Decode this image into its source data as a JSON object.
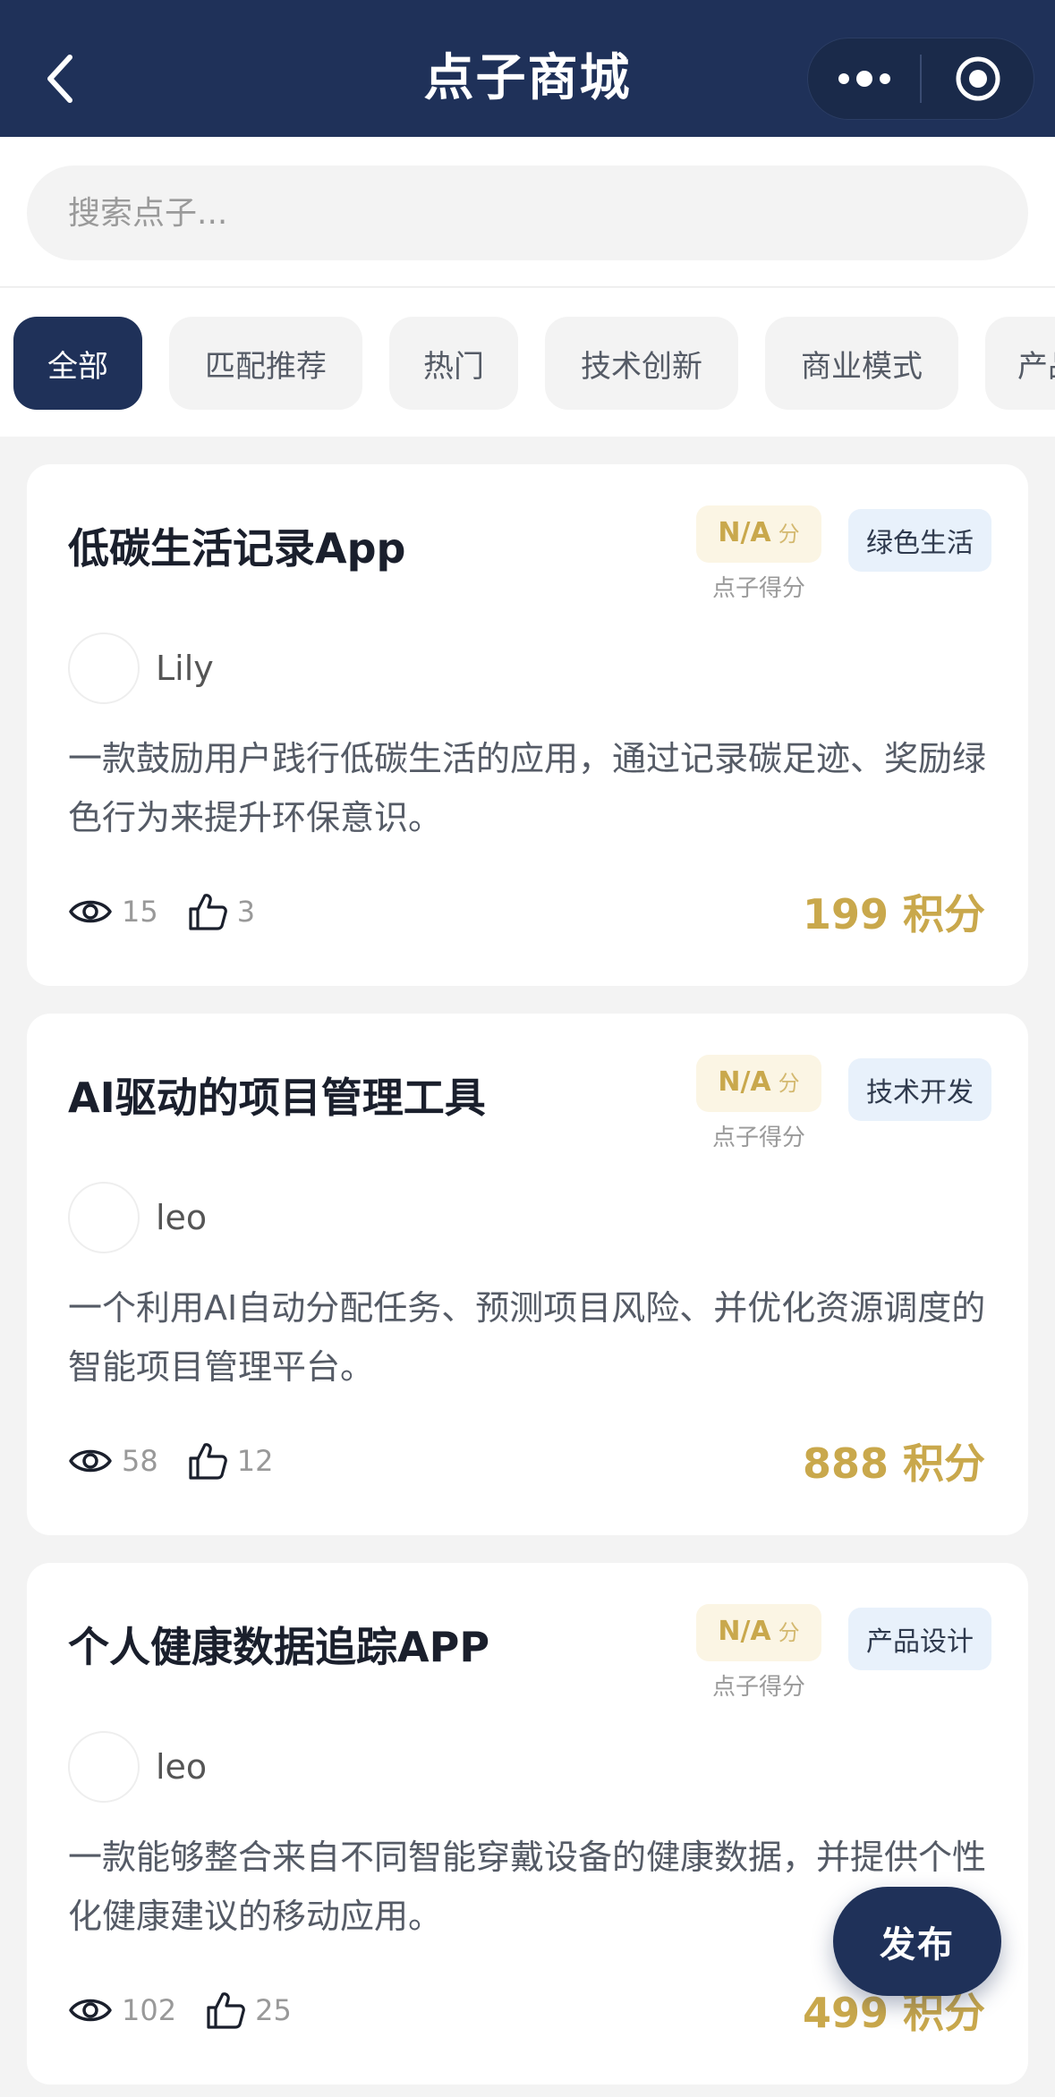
{
  "nav": {
    "title": "点子商城",
    "back_icon": "chevron-left-icon",
    "more_icon": "more-dots-icon",
    "close_icon": "target-circle-icon"
  },
  "search": {
    "placeholder": "搜索点子..."
  },
  "tabs": [
    {
      "label": "全部",
      "active": true
    },
    {
      "label": "匹配推荐",
      "active": false
    },
    {
      "label": "热门",
      "active": false
    },
    {
      "label": "技术创新",
      "active": false
    },
    {
      "label": "商业模式",
      "active": false
    },
    {
      "label": "产品",
      "active": false
    }
  ],
  "cards": [
    {
      "title": "低碳生活记录App",
      "score_value": "N/A",
      "score_unit": "分",
      "score_label": "点子得分",
      "tag": "绿色生活",
      "author": "Lily",
      "description": "一款鼓励用户践行低碳生活的应用，通过记录碳足迹、奖励绿色行为来提升环保意识。",
      "views": "15",
      "likes": "3",
      "price": "199 积分"
    },
    {
      "title": "AI驱动的项目管理工具",
      "score_value": "N/A",
      "score_unit": "分",
      "score_label": "点子得分",
      "tag": "技术开发",
      "author": "leo",
      "description": "一个利用AI自动分配任务、预测项目风险、并优化资源调度的智能项目管理平台。",
      "views": "58",
      "likes": "12",
      "price": "888 积分"
    },
    {
      "title": "个人健康数据追踪APP",
      "score_value": "N/A",
      "score_unit": "分",
      "score_label": "点子得分",
      "tag": "产品设计",
      "author": "leo",
      "description": "一款能够整合来自不同智能穿戴设备的健康数据，并提供个性化健康建议的移动应用。",
      "views": "102",
      "likes": "25",
      "price": "499 积分"
    }
  ],
  "fab": {
    "label": "发布"
  },
  "colors": {
    "primary": "#1f3159",
    "gold": "#c9a84c",
    "tag_bg": "#e8f1fb",
    "score_bg": "#fbf5e4"
  },
  "icons": {
    "views": "eye-icon",
    "likes": "thumbs-up-icon"
  }
}
